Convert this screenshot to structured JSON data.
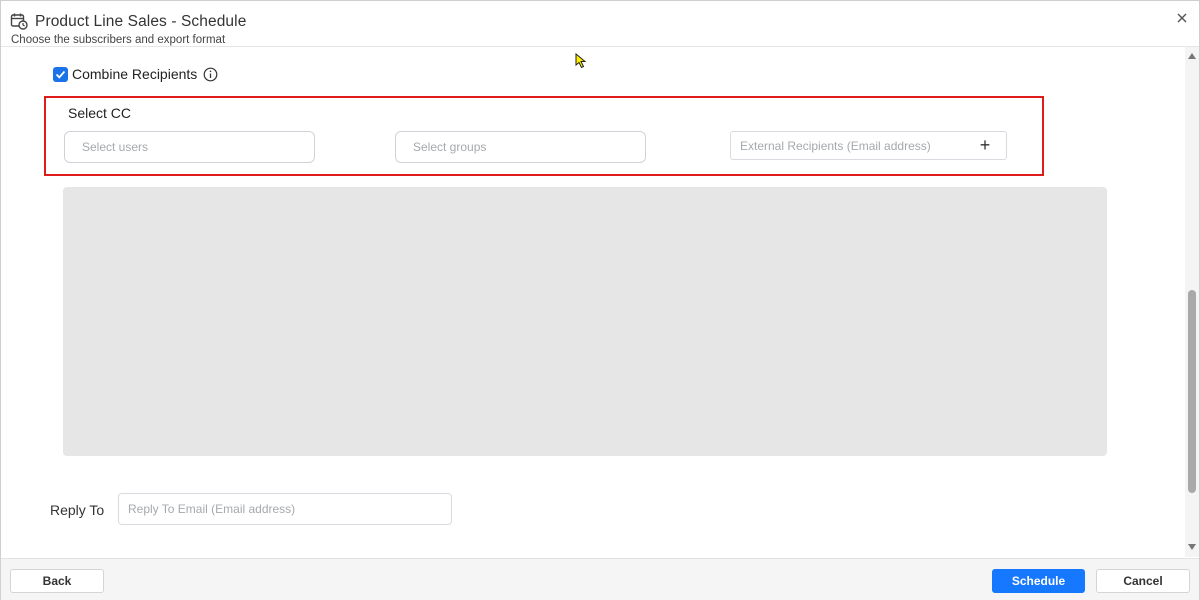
{
  "dialog": {
    "title": "Product Line Sales - Schedule",
    "subtitle": "Choose the subscribers and export format",
    "title_icon": "calendar-clock-icon",
    "close_icon": "close-icon"
  },
  "combine_recipients": {
    "label": "Combine Recipients",
    "checked": true,
    "info_icon": "info-icon"
  },
  "select_cc": {
    "title": "Select CC",
    "users_placeholder": "Select users",
    "groups_placeholder": "Select groups",
    "external_placeholder": "External Recipients (Email address)",
    "add_symbol": "+"
  },
  "reply_to": {
    "label": "Reply To",
    "placeholder": "Reply To Email (Email address)"
  },
  "footer": {
    "back_label": "Back",
    "schedule_label": "Schedule",
    "cancel_label": "Cancel"
  },
  "colors": {
    "primary": "#1677ff",
    "highlight_border": "#e01b1b",
    "panel_grey": "#e6e6e6"
  }
}
